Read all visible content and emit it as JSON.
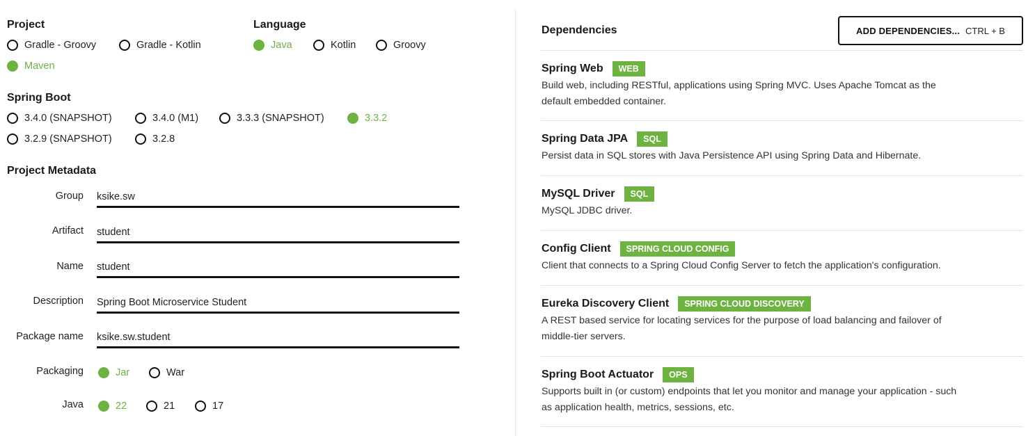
{
  "project": {
    "title": "Project",
    "options": [
      "Gradle - Groovy",
      "Gradle - Kotlin",
      "Maven"
    ],
    "selected": "Maven"
  },
  "language": {
    "title": "Language",
    "options": [
      "Java",
      "Kotlin",
      "Groovy"
    ],
    "selected": "Java"
  },
  "spring_boot": {
    "title": "Spring Boot",
    "options": [
      "3.4.0 (SNAPSHOT)",
      "3.4.0 (M1)",
      "3.3.3 (SNAPSHOT)",
      "3.3.2",
      "3.2.9 (SNAPSHOT)",
      "3.2.8"
    ],
    "selected": "3.3.2"
  },
  "metadata": {
    "title": "Project Metadata",
    "group": {
      "label": "Group",
      "value": "ksike.sw"
    },
    "artifact": {
      "label": "Artifact",
      "value": "student"
    },
    "name": {
      "label": "Name",
      "value": "student"
    },
    "description": {
      "label": "Description",
      "value": "Spring Boot Microservice Student"
    },
    "package_name": {
      "label": "Package name",
      "value": "ksike.sw.student"
    },
    "packaging": {
      "label": "Packaging",
      "options": [
        "Jar",
        "War"
      ],
      "selected": "Jar"
    },
    "java": {
      "label": "Java",
      "options": [
        "22",
        "21",
        "17"
      ],
      "selected": "22"
    }
  },
  "dependencies": {
    "title": "Dependencies",
    "add_button": {
      "label": "ADD DEPENDENCIES...",
      "shortcut": "CTRL + B"
    },
    "items": [
      {
        "name": "Spring Web",
        "tag": "WEB",
        "desc_lines": [
          "Build web, including RESTful, applications using Spring MVC. Uses Apache Tomcat as the",
          "default embedded container."
        ]
      },
      {
        "name": "Spring Data JPA",
        "tag": "SQL",
        "desc_lines": [
          "Persist data in SQL stores with Java Persistence API using Spring Data and Hibernate."
        ]
      },
      {
        "name": "MySQL Driver",
        "tag": "SQL",
        "desc_lines": [
          "MySQL JDBC driver."
        ]
      },
      {
        "name": "Config Client",
        "tag": "SPRING CLOUD CONFIG",
        "desc_lines": [
          "Client that connects to a Spring Cloud Config Server to fetch the application's configuration."
        ]
      },
      {
        "name": "Eureka Discovery Client",
        "tag": "SPRING CLOUD DISCOVERY",
        "desc_lines": [
          "A REST based service for locating services for the purpose of load balancing and failover of",
          "middle-tier servers."
        ]
      },
      {
        "name": "Spring Boot Actuator",
        "tag": "OPS",
        "desc_lines": [
          "Supports built in (or custom) endpoints that let you monitor and manage your application - such",
          "as application health, metrics, sessions, etc."
        ]
      }
    ]
  },
  "colors": {
    "accent": "#6db33f",
    "text": "#222222",
    "border": "#111111",
    "divider": "#e4e4e4"
  }
}
